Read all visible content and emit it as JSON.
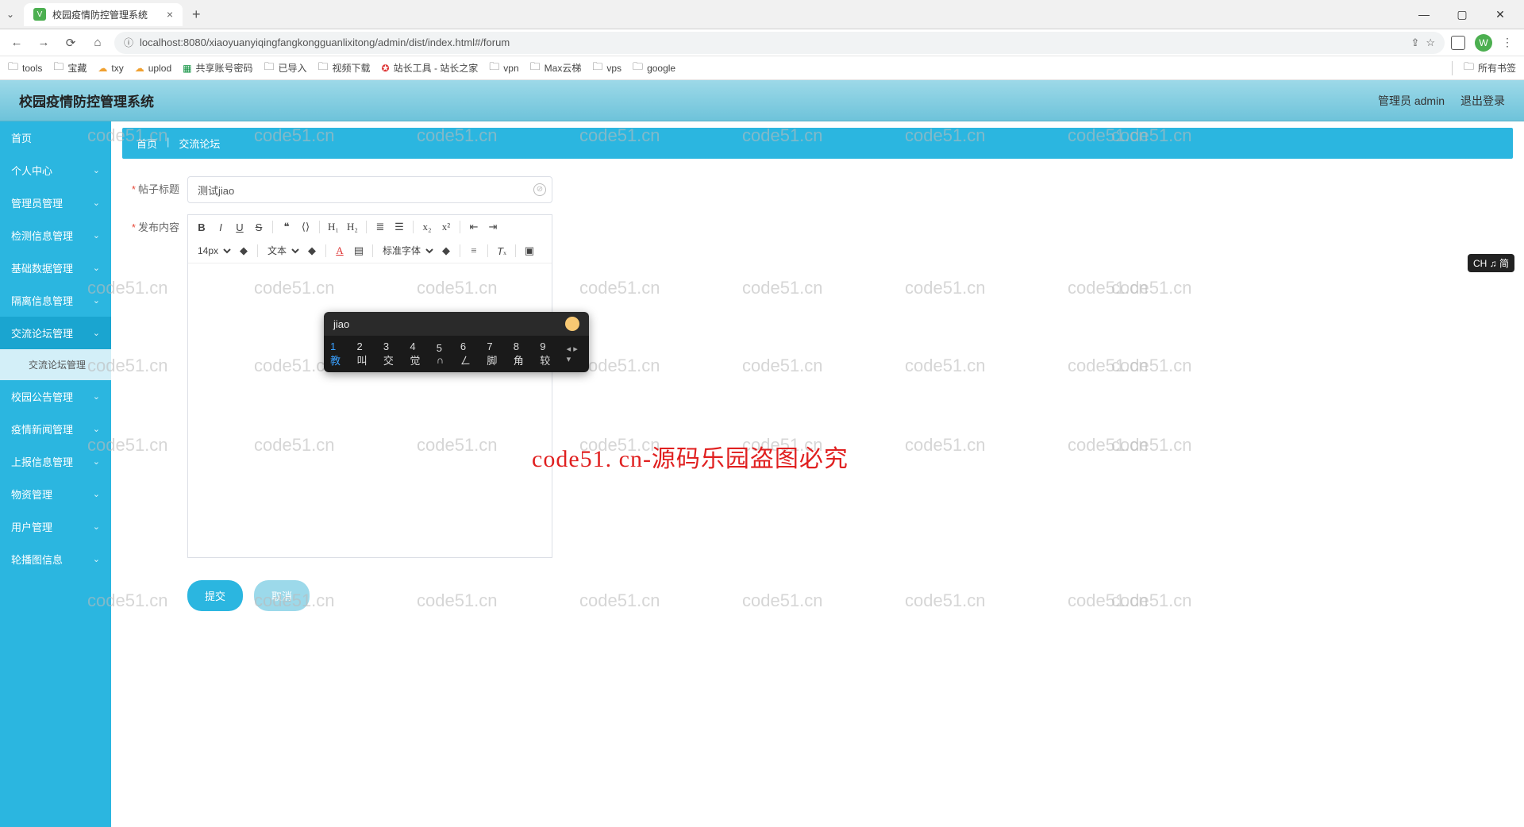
{
  "browser": {
    "tab_title": "校园疫情防控管理系统",
    "url": "localhost:8080/xiaoyuanyiqingfangkongguanlixitong/admin/dist/index.html#/forum",
    "avatar_letter": "W",
    "bookmarks": [
      "tools",
      "宝藏",
      "txy",
      "uplod",
      "共享账号密码",
      "已导入",
      "视频下载",
      "站长工具 - 站长之家",
      "vpn",
      "Max云梯",
      "vps",
      "google"
    ],
    "all_bookmarks": "所有书签"
  },
  "app": {
    "title": "校园疫情防控管理系统",
    "user_label": "管理员 admin",
    "logout": "退出登录"
  },
  "sidebar": {
    "items": [
      {
        "label": "首页",
        "expandable": false
      },
      {
        "label": "个人中心",
        "expandable": true
      },
      {
        "label": "管理员管理",
        "expandable": true
      },
      {
        "label": "检测信息管理",
        "expandable": true
      },
      {
        "label": "基础数据管理",
        "expandable": true
      },
      {
        "label": "隔离信息管理",
        "expandable": true
      },
      {
        "label": "交流论坛管理",
        "expandable": true,
        "active": true
      },
      {
        "label": "校园公告管理",
        "expandable": true
      },
      {
        "label": "疫情新闻管理",
        "expandable": true
      },
      {
        "label": "上报信息管理",
        "expandable": true
      },
      {
        "label": "物资管理",
        "expandable": true
      },
      {
        "label": "用户管理",
        "expandable": true
      },
      {
        "label": "轮播图信息",
        "expandable": true
      }
    ],
    "sub_active": "交流论坛管理"
  },
  "breadcrumb": {
    "home": "首页",
    "current": "交流论坛"
  },
  "form": {
    "title_label": "帖子标题",
    "title_value": "测试jiao",
    "content_label": "发布内容",
    "font_size": "14px",
    "text_type": "文本",
    "font_family": "标准字体"
  },
  "ime": {
    "composing": "jiao",
    "candidates": [
      "1 教",
      "2 叫",
      "3 交",
      "4 觉",
      "5 ∩",
      "6 ㄥ",
      "7 脚",
      "8 角",
      "9 较"
    ],
    "badge": "CH ♫ 简"
  },
  "buttons": {
    "submit": "提交",
    "cancel": "取消"
  },
  "watermark": {
    "repeat": "code51.cn",
    "big": "code51. cn-源码乐园盗图必究"
  }
}
